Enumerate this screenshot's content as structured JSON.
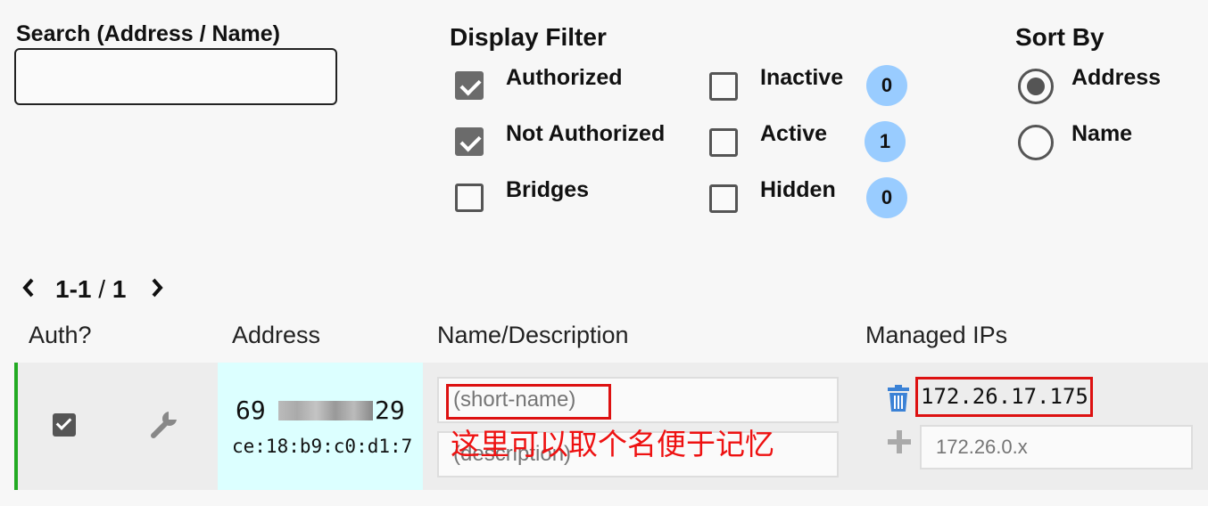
{
  "search": {
    "label": "Search (Address / Name)",
    "value": "",
    "placeholder": ""
  },
  "filter": {
    "title": "Display Filter",
    "options": [
      {
        "label": "Authorized",
        "checked": true
      },
      {
        "label": "Not Authorized",
        "checked": true
      },
      {
        "label": "Bridges",
        "checked": false
      },
      {
        "label": "Inactive",
        "checked": false,
        "count": "0"
      },
      {
        "label": "Active",
        "checked": false,
        "count": "1"
      },
      {
        "label": "Hidden",
        "checked": false,
        "count": "0"
      }
    ]
  },
  "sort": {
    "title": "Sort By",
    "options": [
      {
        "label": "Address",
        "selected": true
      },
      {
        "label": "Name",
        "selected": false
      }
    ]
  },
  "pager": {
    "prev_icon": "chevron-left",
    "range": "1-1",
    "separator": "/",
    "total": "1",
    "next_icon": "chevron-right"
  },
  "table": {
    "headers": {
      "auth": "Auth?",
      "address": "Address",
      "name": "Name/Description",
      "ips": "Managed IPs"
    },
    "rows": [
      {
        "authorized": true,
        "settings_icon": "wrench-icon",
        "address_start": "69",
        "address_end": "29",
        "mac": "ce:18:b9:c0:d1:7",
        "name_placeholder": "(short-name)",
        "description_placeholder": "(description)",
        "ip": "172.26.17.175",
        "ip_add_placeholder": "172.26.0.x"
      }
    ]
  },
  "annotation": {
    "text": "这里可以取个名便于记忆",
    "color": "#ee1111"
  },
  "colors": {
    "row_accent": "#22aa22",
    "address_cell": "#dcffff",
    "badge": "#99ccff",
    "trash": "#3b82d6"
  }
}
